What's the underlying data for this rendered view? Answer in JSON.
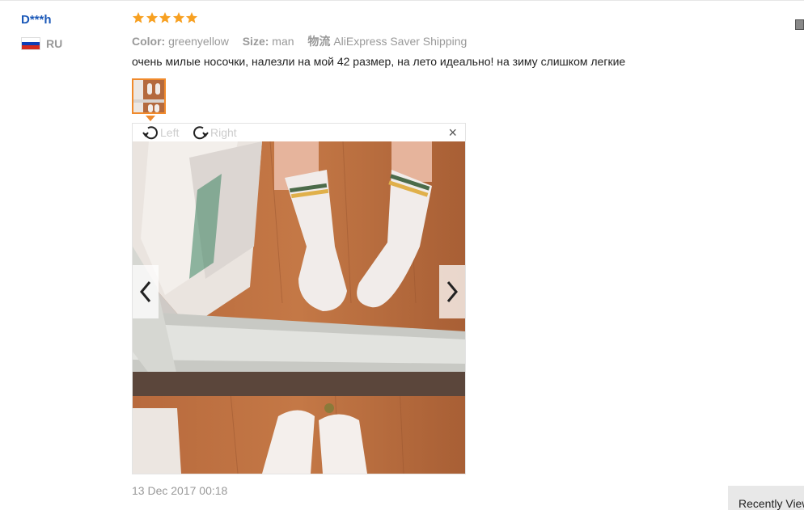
{
  "user": {
    "name": "D***h",
    "country_code": "RU",
    "flag_colors": [
      "#ffffff",
      "#0d3fb8",
      "#d52b1e"
    ]
  },
  "rating": {
    "stars": 5,
    "color": "#f7a021"
  },
  "attributes": {
    "color_label": "Color:",
    "color_value": "greenyellow",
    "size_label": "Size:",
    "size_value": "man",
    "shipping_label": "物流",
    "shipping_value": "AliExpress Saver Shipping"
  },
  "review_text": "очень милые носочки, налезли на мой 42 размер, на лето идеально! на зиму слишком легкие",
  "viewer": {
    "rotate_left": "Left",
    "rotate_right": "Right",
    "close": "×"
  },
  "date": "13 Dec 2017 00:18",
  "recently_viewed": "Recently Viewed",
  "accent": "#f08a2c",
  "link_color": "#1a58b8"
}
